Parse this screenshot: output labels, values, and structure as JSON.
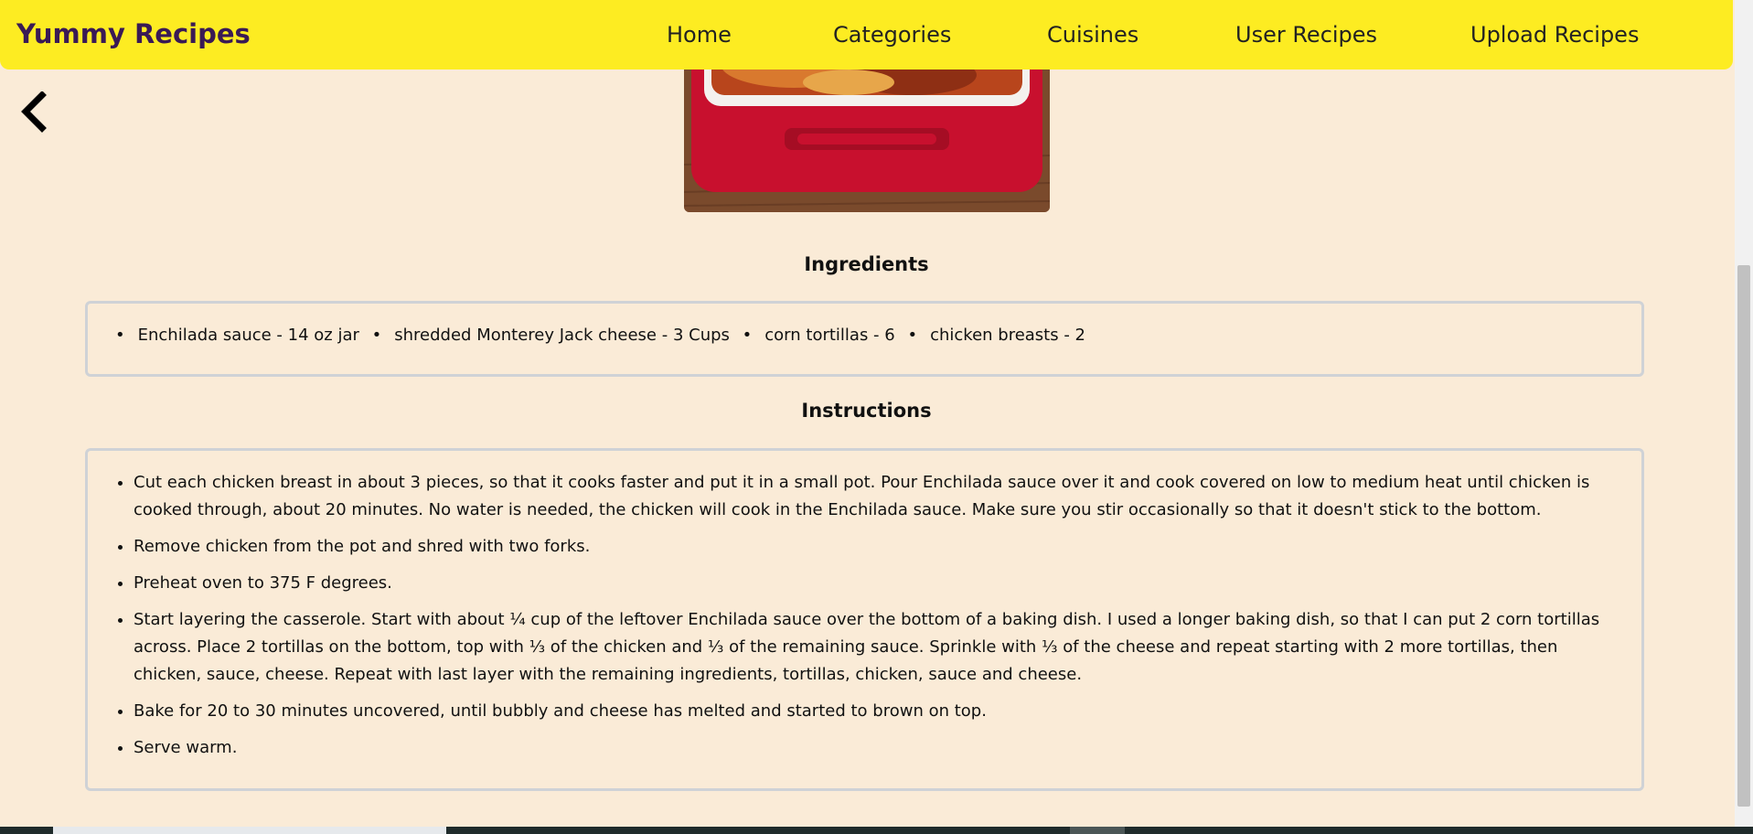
{
  "navbar": {
    "brand": "Yummy Recipes",
    "links": [
      "Home",
      "Categories",
      "Cuisines",
      "User Recipes",
      "Upload Recipes"
    ]
  },
  "back_icon": "chevron-left-icon",
  "ingredients": {
    "title": "Ingredients",
    "items": [
      "Enchilada sauce - 14 oz jar",
      "shredded Monterey Jack cheese - 3 Cups",
      "corn tortillas - 6",
      "chicken breasts - 2"
    ]
  },
  "instructions": {
    "title": "Instructions",
    "steps": [
      "Cut each chicken breast in about 3 pieces, so that it cooks faster and put it in a small pot. Pour Enchilada sauce over it and cook covered on low to medium heat until chicken is cooked through, about 20 minutes. No water is needed, the chicken will cook in the Enchilada sauce. Make sure you stir occasionally so that it doesn't stick to the bottom.",
      "Remove chicken from the pot and shred with two forks.",
      "Preheat oven to 375 F degrees.",
      "Start layering the casserole. Start with about ¼ cup of the leftover Enchilada sauce over the bottom of a baking dish. I used a longer baking dish, so that I can put 2 corn tortillas across. Place 2 tortillas on the bottom, top with ⅓ of the chicken and ⅓ of the remaining sauce. Sprinkle with ⅓ of the cheese and repeat starting with 2 more tortillas, then chicken, sauce, cheese. Repeat with last layer with the remaining ingredients, tortillas, chicken, sauce and cheese.",
      "Bake for 20 to 30 minutes uncovered, until bubbly and cheese has melted and started to brown on top.",
      "Serve warm."
    ]
  },
  "colors": {
    "navbar": "#fdec22",
    "brand": "#3a1a55",
    "page_background": "#faebd7",
    "box_border": "#cfd2d6"
  }
}
